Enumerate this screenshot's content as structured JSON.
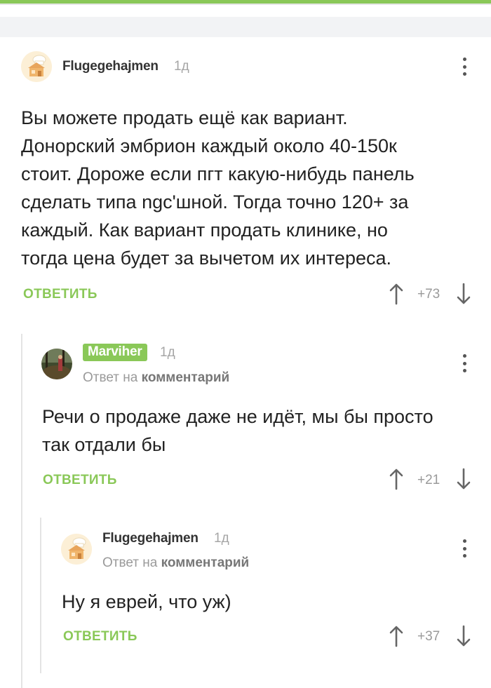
{
  "comments": [
    {
      "author": "Flugegehajmen",
      "time": "1д",
      "text_lines": [
        "Вы можете продать ещё как вариант.",
        "Донорский эмбрион каждый около 40-150к",
        "стоит. Дороже если пгт какую-нибудь панель",
        "сделать типа ngc'шной. Тогда точно 120+ за",
        "каждый. Как вариант продать клинике, но",
        "тогда цена будет за вычетом их интереса."
      ],
      "reply_label": "ОТВЕТИТЬ",
      "rating": "+73",
      "avatar_icon": "chef-hat-house-icon"
    },
    {
      "author": "Marviher",
      "time": "1д",
      "reply_to_prefix": "Ответ на",
      "reply_to_link": "комментарий",
      "text_lines": [
        "Речи о продаже даже не идёт, мы бы просто",
        "так отдали бы"
      ],
      "reply_label": "ОТВЕТИТЬ",
      "rating": "+21",
      "avatar_icon": "forest-photo-icon"
    },
    {
      "author": "Flugegehajmen",
      "time": "1д",
      "reply_to_prefix": "Ответ на",
      "reply_to_link": "комментарий",
      "text_lines": [
        "Ну я еврей, что уж)"
      ],
      "reply_label": "ОТВЕТИТЬ",
      "rating": "+37",
      "avatar_icon": "chef-hat-house-icon"
    }
  ],
  "colors": {
    "accent": "#8ac858",
    "text": "#222222",
    "muted": "#9a9a9a"
  }
}
